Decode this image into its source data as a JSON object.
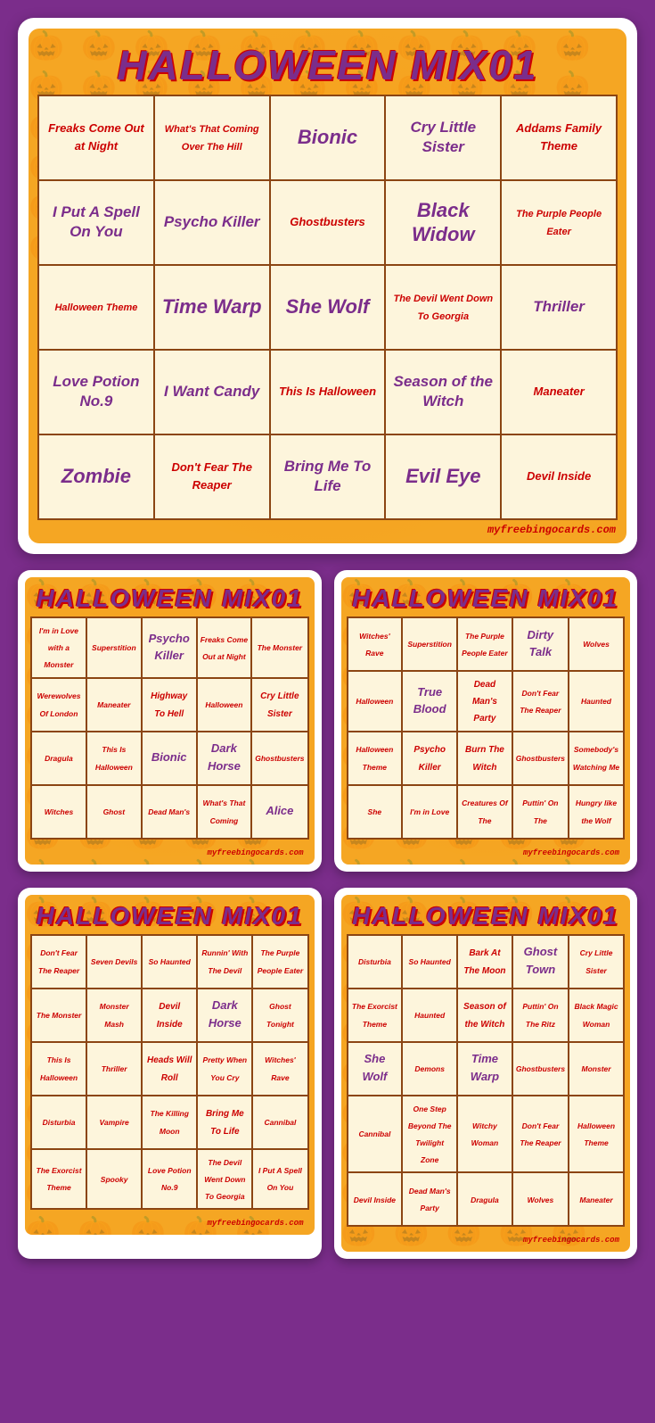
{
  "main_card": {
    "title": "HALLOWEEN MIX01",
    "website": "myfreebingocards.com",
    "rows": [
      [
        {
          "text": "Freaks Come Out at Night",
          "size": "md"
        },
        {
          "text": "What's That Coming Over The Hill",
          "size": "sm"
        },
        {
          "text": "Bionic",
          "size": "xl"
        },
        {
          "text": "Cry Little Sister",
          "size": "lg"
        },
        {
          "text": "Addams Family Theme",
          "size": "md"
        }
      ],
      [
        {
          "text": "I Put A Spell On You",
          "size": "lg"
        },
        {
          "text": "Psycho Killer",
          "size": "lg"
        },
        {
          "text": "Ghostbusters",
          "size": "md"
        },
        {
          "text": "Black Widow",
          "size": "xl"
        },
        {
          "text": "The Purple People Eater",
          "size": "sm"
        }
      ],
      [
        {
          "text": "Halloween Theme",
          "size": "sm"
        },
        {
          "text": "Time Warp",
          "size": "xl"
        },
        {
          "text": "She Wolf",
          "size": "xl"
        },
        {
          "text": "The Devil Went Down To Georgia",
          "size": "sm"
        },
        {
          "text": "Thriller",
          "size": "lg"
        }
      ],
      [
        {
          "text": "Love Potion No.9",
          "size": "lg"
        },
        {
          "text": "I Want Candy",
          "size": "lg"
        },
        {
          "text": "This Is Halloween",
          "size": "md"
        },
        {
          "text": "Season of the Witch",
          "size": "lg"
        },
        {
          "text": "Maneater",
          "size": "md"
        }
      ],
      [
        {
          "text": "Zombie",
          "size": "xl"
        },
        {
          "text": "Don't Fear The Reaper",
          "size": "md"
        },
        {
          "text": "Bring Me To Life",
          "size": "lg"
        },
        {
          "text": "Evil Eye",
          "size": "xl"
        },
        {
          "text": "Devil Inside",
          "size": "md"
        }
      ]
    ]
  },
  "card2": {
    "title": "HALLOWEEN MIX01",
    "website": "myfreebingocards.com",
    "rows": [
      [
        {
          "text": "I'm in Love with a Monster",
          "size": "sm"
        },
        {
          "text": "Superstition",
          "size": "sm"
        },
        {
          "text": "Psycho Killer",
          "size": "mini-lg"
        },
        {
          "text": "Freaks Come Out at Night",
          "size": "mini-sm"
        },
        {
          "text": "The Monster",
          "size": "mini-sm"
        }
      ],
      [
        {
          "text": "Werewolves Of London",
          "size": "mini-sm"
        },
        {
          "text": "Maneater",
          "size": "mini-sm"
        },
        {
          "text": "Highway To Hell",
          "size": "mini-md"
        },
        {
          "text": "Halloween",
          "size": "mini-sm"
        },
        {
          "text": "Cry Little Sister",
          "size": "mini-md"
        }
      ],
      [
        {
          "text": "Dragula",
          "size": "mini-sm"
        },
        {
          "text": "This Is Halloween",
          "size": "mini-sm"
        },
        {
          "text": "Bionic",
          "size": "mini-lg"
        },
        {
          "text": "Dark Horse",
          "size": "mini-lg"
        },
        {
          "text": "Ghostbusters",
          "size": "mini-sm"
        }
      ],
      [
        {
          "text": "Witches",
          "size": "mini-sm"
        },
        {
          "text": "Ghost",
          "size": "mini-sm"
        },
        {
          "text": "Dead Man's",
          "size": "mini-sm"
        },
        {
          "text": "What's That Coming",
          "size": "mini-sm"
        },
        {
          "text": "Alice",
          "size": "mini-lg"
        }
      ]
    ]
  },
  "card3": {
    "title": "HALLOWEEN MIX01",
    "website": "myfreebingocards.com",
    "rows": [
      [
        {
          "text": "Witches' Rave",
          "size": "mini-sm"
        },
        {
          "text": "Superstition",
          "size": "mini-sm"
        },
        {
          "text": "The Purple People Eater",
          "size": "mini-sm"
        },
        {
          "text": "Dirty Talk",
          "size": "mini-lg"
        },
        {
          "text": "Wolves",
          "size": "mini-sm"
        }
      ],
      [
        {
          "text": "Halloween",
          "size": "mini-sm"
        },
        {
          "text": "True Blood",
          "size": "mini-lg"
        },
        {
          "text": "Dead Man's Party",
          "size": "mini-md"
        },
        {
          "text": "Don't Fear The Reaper",
          "size": "mini-sm"
        },
        {
          "text": "Haunted",
          "size": "mini-sm"
        }
      ],
      [
        {
          "text": "Halloween Theme",
          "size": "mini-sm"
        },
        {
          "text": "Psycho Killer",
          "size": "mini-md"
        },
        {
          "text": "Burn The Witch",
          "size": "mini-md"
        },
        {
          "text": "Ghostbusters",
          "size": "mini-sm"
        },
        {
          "text": "Somebody's Watching Me",
          "size": "mini-sm"
        }
      ],
      [
        {
          "text": "She",
          "size": "mini-sm"
        },
        {
          "text": "I'm in Love",
          "size": "mini-sm"
        },
        {
          "text": "Creatures Of The",
          "size": "mini-sm"
        },
        {
          "text": "Puttin' On The",
          "size": "mini-sm"
        },
        {
          "text": "Hungry like the Wolf",
          "size": "mini-sm"
        }
      ]
    ]
  },
  "card4": {
    "title": "HALLOWEEN MIX01",
    "website": "myfreebingocards.com",
    "rows": [
      [
        {
          "text": "Don't Fear The Reaper",
          "size": "mini-sm"
        },
        {
          "text": "Seven Devils",
          "size": "mini-sm"
        },
        {
          "text": "So Haunted",
          "size": "mini-sm"
        },
        {
          "text": "Runnin' With The Devil",
          "size": "mini-sm"
        },
        {
          "text": "The Purple People Eater",
          "size": "mini-sm"
        }
      ],
      [
        {
          "text": "The Monster",
          "size": "mini-sm"
        },
        {
          "text": "Monster Mash",
          "size": "mini-sm"
        },
        {
          "text": "Devil Inside",
          "size": "mini-md"
        },
        {
          "text": "Dark Horse",
          "size": "mini-lg"
        },
        {
          "text": "Ghost Tonight",
          "size": "mini-sm"
        }
      ],
      [
        {
          "text": "This Is Halloween",
          "size": "mini-sm"
        },
        {
          "text": "Thriller",
          "size": "mini-sm"
        },
        {
          "text": "Heads Will Roll",
          "size": "mini-md"
        },
        {
          "text": "Pretty When You Cry",
          "size": "mini-sm"
        },
        {
          "text": "Witches' Rave",
          "size": "mini-sm"
        }
      ],
      [
        {
          "text": "Disturbia",
          "size": "mini-sm"
        },
        {
          "text": "Vampire",
          "size": "mini-sm"
        },
        {
          "text": "The Killing Moon",
          "size": "mini-sm"
        },
        {
          "text": "Bring Me To Life",
          "size": "mini-md"
        },
        {
          "text": "Cannibal",
          "size": "mini-sm"
        }
      ],
      [
        {
          "text": "The Exorcist Theme",
          "size": "mini-sm"
        },
        {
          "text": "Spooky",
          "size": "mini-sm"
        },
        {
          "text": "Love Potion No.9",
          "size": "mini-sm"
        },
        {
          "text": "The Devil Went Down To Georgia",
          "size": "mini-sm"
        },
        {
          "text": "I Put A Spell On You",
          "size": "mini-sm"
        }
      ]
    ]
  },
  "card5": {
    "title": "HALLOWEEN MIX01",
    "website": "myfreebingocards.com",
    "rows": [
      [
        {
          "text": "Disturbia",
          "size": "mini-sm"
        },
        {
          "text": "So Haunted",
          "size": "mini-sm"
        },
        {
          "text": "Bark At The Moon",
          "size": "mini-md"
        },
        {
          "text": "Ghost Town",
          "size": "mini-lg"
        },
        {
          "text": "Cry Little Sister",
          "size": "mini-sm"
        }
      ],
      [
        {
          "text": "The Exorcist Theme",
          "size": "mini-sm"
        },
        {
          "text": "Haunted",
          "size": "mini-sm"
        },
        {
          "text": "Season of the Witch",
          "size": "mini-md"
        },
        {
          "text": "Puttin' On The Ritz",
          "size": "mini-sm"
        },
        {
          "text": "Black Magic Woman",
          "size": "mini-sm"
        }
      ],
      [
        {
          "text": "She Wolf",
          "size": "mini-lg"
        },
        {
          "text": "Demons",
          "size": "mini-sm"
        },
        {
          "text": "Time Warp",
          "size": "mini-lg"
        },
        {
          "text": "Ghostbusters",
          "size": "mini-sm"
        },
        {
          "text": "Monster",
          "size": "mini-sm"
        }
      ],
      [
        {
          "text": "Cannibal",
          "size": "mini-sm"
        },
        {
          "text": "One Step Beyond The Twilight Zone",
          "size": "mini-sm"
        },
        {
          "text": "Witchy Woman",
          "size": "mini-sm"
        },
        {
          "text": "Don't Fear The Reaper",
          "size": "mini-sm"
        },
        {
          "text": "Halloween Theme",
          "size": "mini-sm"
        }
      ],
      [
        {
          "text": "Devil Inside",
          "size": "mini-sm"
        },
        {
          "text": "Dead Man's Party",
          "size": "mini-sm"
        },
        {
          "text": "Dragula",
          "size": "mini-sm"
        },
        {
          "text": "Wolves",
          "size": "mini-sm"
        },
        {
          "text": "Maneater",
          "size": "mini-sm"
        }
      ]
    ]
  }
}
